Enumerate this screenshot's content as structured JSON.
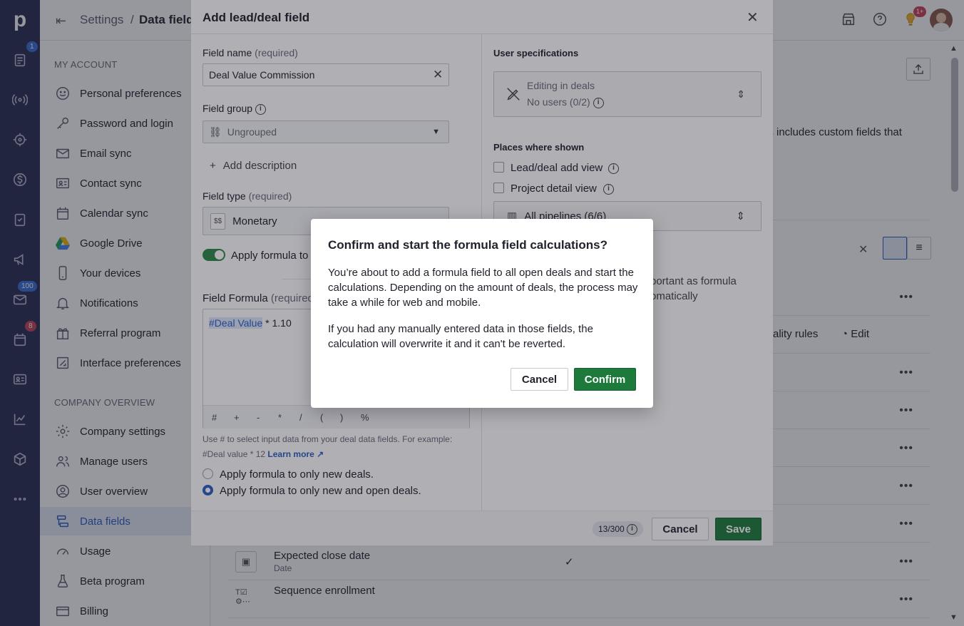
{
  "rail": {
    "logo": "p",
    "badges": {
      "deals": "1",
      "mail": "100",
      "calendar": "8"
    }
  },
  "topbar": {
    "crumb_root": "Settings",
    "crumb_sep": "/",
    "crumb_current": "Data fields",
    "tips_badge": "1+"
  },
  "sidebar": {
    "my_account_title": "MY ACCOUNT",
    "my_account": [
      {
        "label": "Personal preferences",
        "icon": "smile-icon"
      },
      {
        "label": "Password and login",
        "icon": "key-icon"
      },
      {
        "label": "Email sync",
        "icon": "mail-icon"
      },
      {
        "label": "Contact sync",
        "icon": "contact-card-icon"
      },
      {
        "label": "Calendar sync",
        "icon": "calendar-icon"
      },
      {
        "label": "Google Drive",
        "icon": "google-drive-icon"
      },
      {
        "label": "Your devices",
        "icon": "phone-icon"
      },
      {
        "label": "Notifications",
        "icon": "bell-icon"
      },
      {
        "label": "Referral program",
        "icon": "gift-icon"
      },
      {
        "label": "Interface preferences",
        "icon": "interface-icon"
      }
    ],
    "company_title": "COMPANY OVERVIEW",
    "company": [
      {
        "label": "Company settings",
        "icon": "gear-icon"
      },
      {
        "label": "Manage users",
        "icon": "users-icon"
      },
      {
        "label": "User overview",
        "icon": "user-circle-icon"
      },
      {
        "label": "Data fields",
        "icon": "data-fields-icon"
      },
      {
        "label": "Usage",
        "icon": "gauge-icon"
      },
      {
        "label": "Beta program",
        "icon": "flask-icon"
      },
      {
        "label": "Billing",
        "icon": "card-icon"
      }
    ]
  },
  "background": {
    "desc_fragment": "is includes custom fields that",
    "rules_fragment": "ality rules",
    "edit_label": "Edit",
    "rows": [
      {
        "title": "Expected close date",
        "subtitle": "Date",
        "check": "✓"
      },
      {
        "title": "Sequence enrollment",
        "subtitle": "",
        "check": ""
      }
    ]
  },
  "modal": {
    "title": "Add lead/deal field",
    "field_name_label": "Field name",
    "required_suffix": "(required)",
    "field_name_value": "Deal Value Commission",
    "field_group_label": "Field group",
    "field_group_value": "Ungrouped",
    "add_description": "Add description",
    "field_type_label": "Field type",
    "field_type_value": "Monetary",
    "field_type_icon_text": "$$",
    "toggle_label": "Apply formula to",
    "formula_label": "Field Formula",
    "formula_required": "(required",
    "formula_token": "#Deal Value",
    "formula_rest": " * 1.10",
    "operators": [
      "#",
      "+",
      "-",
      "*",
      "/",
      "(",
      ")",
      "%"
    ],
    "hint_text": "Use # to select input data from your deal data fields. For example: #Deal value * 12",
    "learn_more": "Learn more",
    "radio_new": "Apply formula to only new deals.",
    "radio_new_open": "Apply formula to only new and open deals.",
    "user_spec_title": "User specifications",
    "editing_line1": "Editing in deals",
    "editing_line2": "No users (0/2)",
    "places_title": "Places where shown",
    "place_add_view": "Lead/deal add view",
    "place_project": "Project detail view",
    "pipelines": "All pipelines (6/6)",
    "note_line1": "portant as formula",
    "note_line2": "omatically",
    "counter": "13/300",
    "cancel": "Cancel",
    "save": "Save"
  },
  "dialog": {
    "title": "Confirm and start the formula field calculations?",
    "para1": "You’re about to add a formula field to all open deals and start the calculations. Depending on the amount of deals, the process may take a while for web and mobile.",
    "para2": "If you had any manually entered data in those fields, the calculation will overwrite it and it can't be reverted.",
    "cancel": "Cancel",
    "confirm": "Confirm"
  }
}
